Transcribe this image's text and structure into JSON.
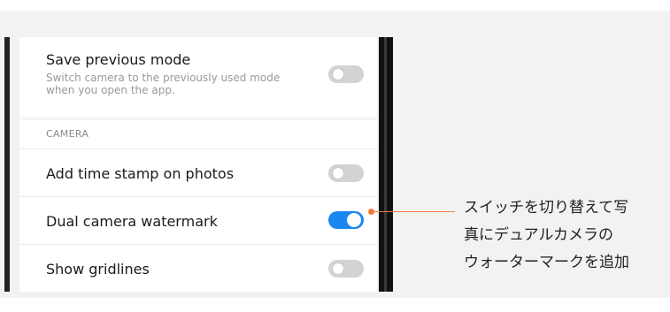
{
  "settings": {
    "save_previous_mode": {
      "title": "Save previous mode",
      "description": "Switch camera to the previously used mode when you open the app.",
      "enabled": false
    },
    "section_camera": "CAMERA",
    "add_time_stamp": {
      "title": "Add time stamp on photos",
      "enabled": false
    },
    "dual_camera_watermark": {
      "title": "Dual camera watermark",
      "enabled": true
    },
    "show_gridlines": {
      "title": "Show gridlines",
      "enabled": false
    }
  },
  "callout": {
    "text": "スイッチを切り替えて写\n真にデュアルカメラの\nウォーターマークを追加"
  },
  "colors": {
    "toggle_on": "#1a86f0",
    "toggle_off": "#d3d3d3",
    "callout_accent": "#ef7b3a"
  }
}
